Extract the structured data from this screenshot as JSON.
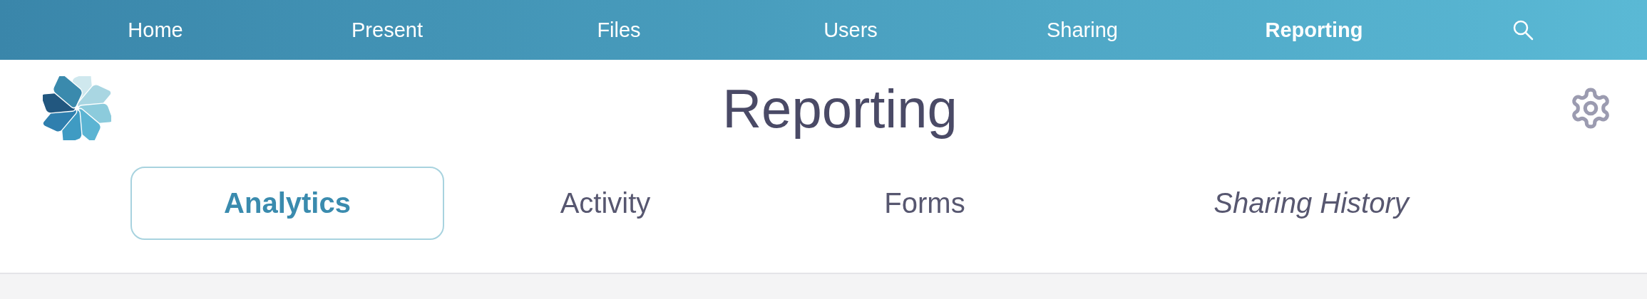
{
  "nav": {
    "items": [
      {
        "label": "Home",
        "selected": false
      },
      {
        "label": "Present",
        "selected": false
      },
      {
        "label": "Files",
        "selected": false
      },
      {
        "label": "Users",
        "selected": false
      },
      {
        "label": "Sharing",
        "selected": false
      },
      {
        "label": "Reporting",
        "selected": true
      }
    ]
  },
  "header": {
    "title": "Reporting"
  },
  "tabs": [
    {
      "label": "Analytics",
      "selected": true,
      "italic": false
    },
    {
      "label": "Activity",
      "selected": false,
      "italic": false
    },
    {
      "label": "Forms",
      "selected": false,
      "italic": false
    },
    {
      "label": "Sharing History",
      "selected": false,
      "italic": true
    }
  ]
}
